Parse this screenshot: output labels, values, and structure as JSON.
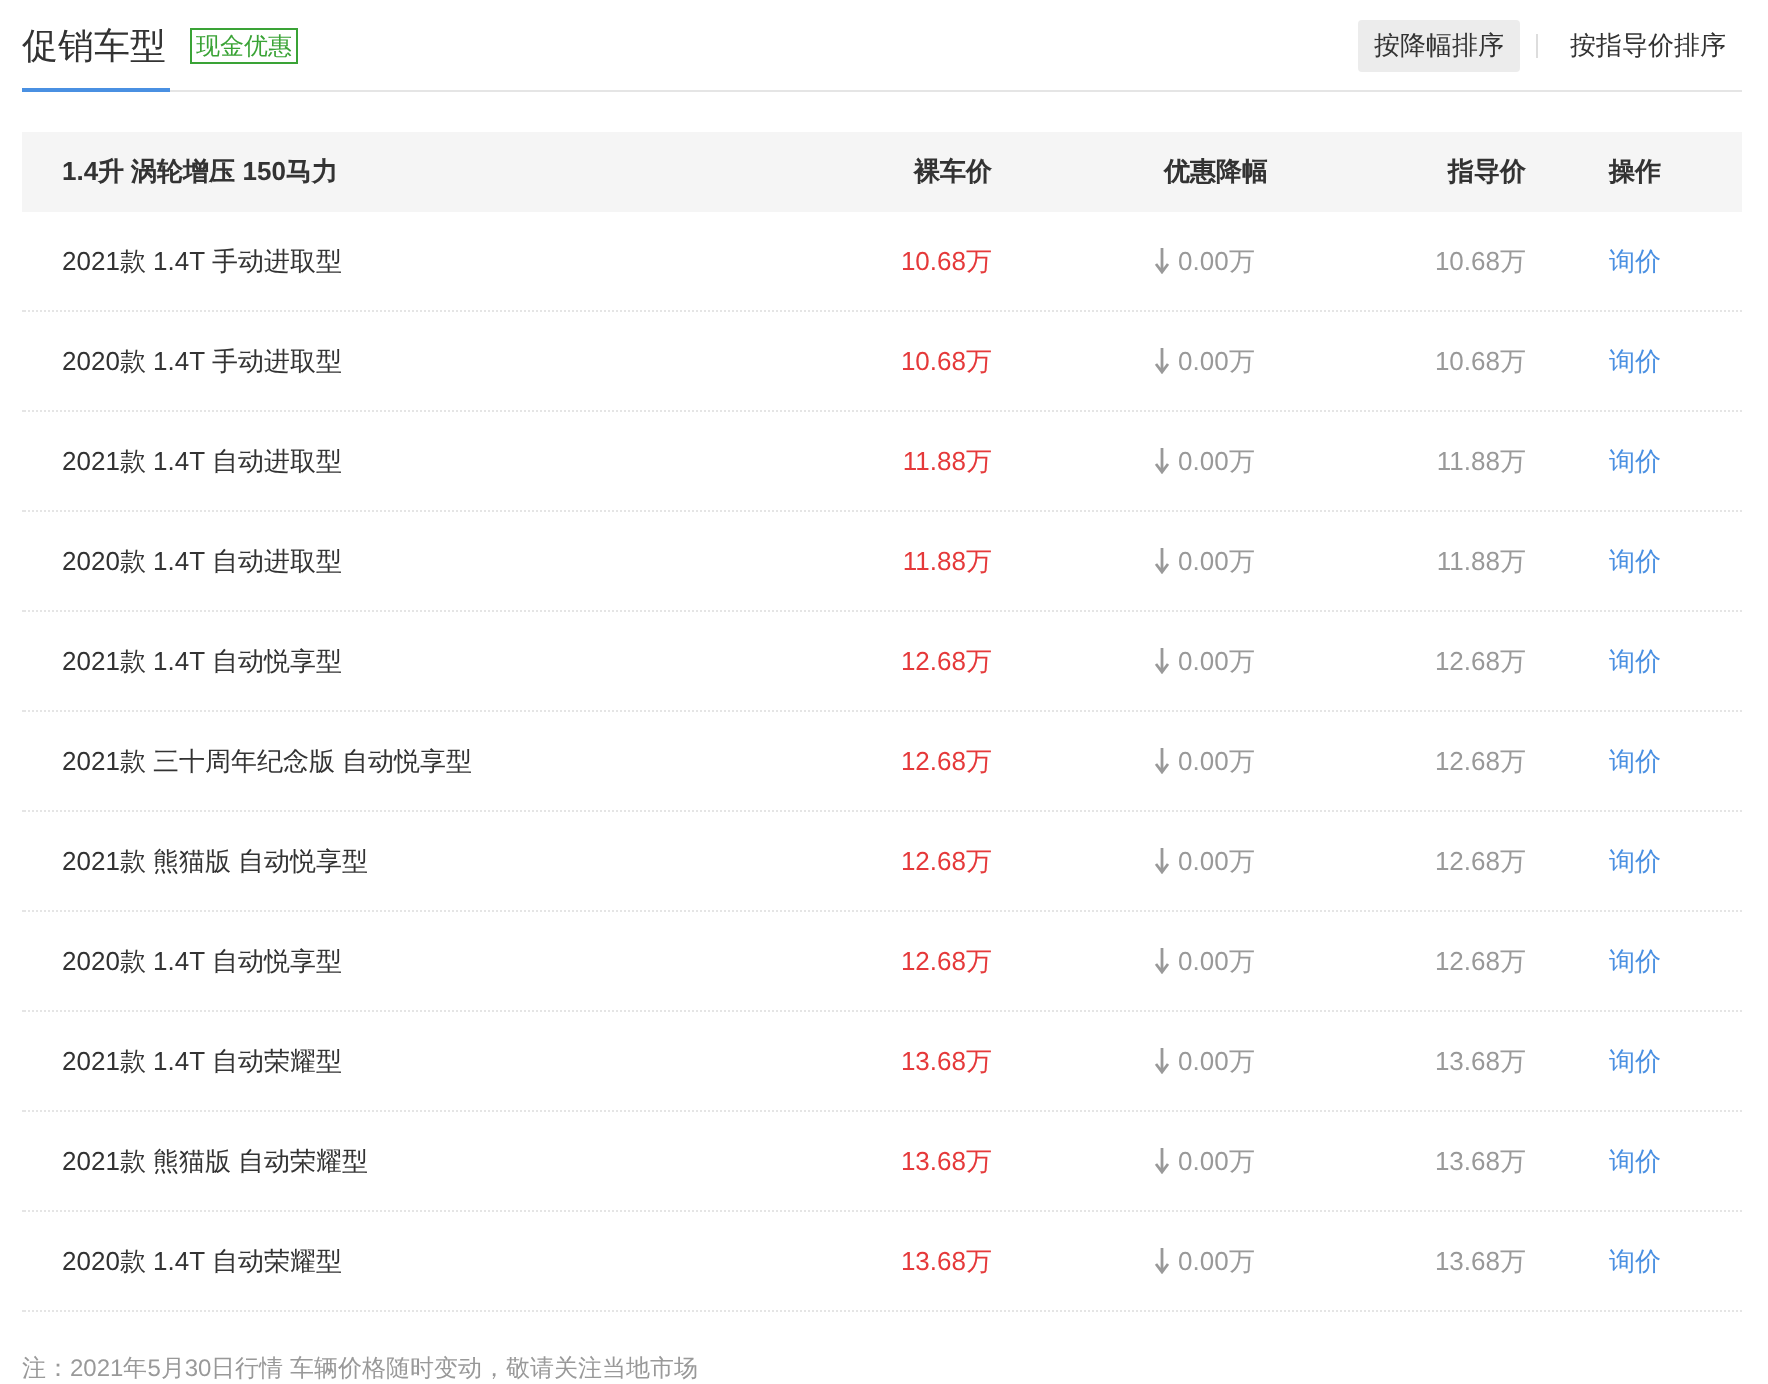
{
  "header": {
    "tab": {
      "label": "促销车型",
      "selected": true
    },
    "badge": "现金优惠",
    "sort_buttons": [
      {
        "label": "按降幅排序",
        "selected": true
      },
      {
        "label": "按指导价排序",
        "selected": false
      }
    ]
  },
  "table": {
    "columns": [
      "1.4升 涡轮增压 150马力",
      "裸车价",
      "优惠降幅",
      "指导价",
      "操作"
    ],
    "rows": [
      {
        "model": "2021款 1.4T 手动进取型",
        "price": "10.68万",
        "discount": "0.00万",
        "guide": "10.68万",
        "action": "询价"
      },
      {
        "model": "2020款 1.4T 手动进取型",
        "price": "10.68万",
        "discount": "0.00万",
        "guide": "10.68万",
        "action": "询价"
      },
      {
        "model": "2021款 1.4T 自动进取型",
        "price": "11.88万",
        "discount": "0.00万",
        "guide": "11.88万",
        "action": "询价"
      },
      {
        "model": "2020款 1.4T 自动进取型",
        "price": "11.88万",
        "discount": "0.00万",
        "guide": "11.88万",
        "action": "询价"
      },
      {
        "model": "2021款 1.4T 自动悦享型",
        "price": "12.68万",
        "discount": "0.00万",
        "guide": "12.68万",
        "action": "询价"
      },
      {
        "model": "2021款 三十周年纪念版 自动悦享型",
        "price": "12.68万",
        "discount": "0.00万",
        "guide": "12.68万",
        "action": "询价"
      },
      {
        "model": "2021款 熊猫版 自动悦享型",
        "price": "12.68万",
        "discount": "0.00万",
        "guide": "12.68万",
        "action": "询价"
      },
      {
        "model": "2020款 1.4T 自动悦享型",
        "price": "12.68万",
        "discount": "0.00万",
        "guide": "12.68万",
        "action": "询价"
      },
      {
        "model": "2021款 1.4T 自动荣耀型",
        "price": "13.68万",
        "discount": "0.00万",
        "guide": "13.68万",
        "action": "询价"
      },
      {
        "model": "2021款 熊猫版 自动荣耀型",
        "price": "13.68万",
        "discount": "0.00万",
        "guide": "13.68万",
        "action": "询价"
      },
      {
        "model": "2020款 1.4T 自动荣耀型",
        "price": "13.68万",
        "discount": "0.00万",
        "guide": "13.68万",
        "action": "询价"
      }
    ]
  },
  "footnote": "注：2021年5月30日行情 车辆价格随时变动，敬请关注当地市场"
}
